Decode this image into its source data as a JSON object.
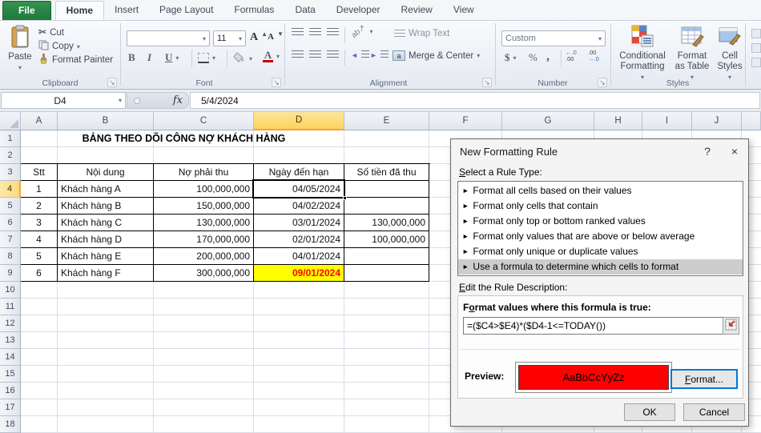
{
  "ribbon": {
    "tabs": [
      "File",
      "Home",
      "Insert",
      "Page Layout",
      "Formulas",
      "Data",
      "Developer",
      "Review",
      "View"
    ],
    "groups": {
      "clipboard": "Clipboard",
      "font": "Font",
      "alignment": "Alignment",
      "number": "Number",
      "styles": "Styles"
    },
    "clipboard": {
      "paste": "Paste",
      "cut": "Cut",
      "copy": "Copy",
      "format_painter": "Format Painter"
    },
    "font": {
      "font_name": "",
      "font_size": "11"
    },
    "alignment": {
      "wrap_text": "Wrap Text",
      "merge_center": "Merge & Center"
    },
    "number": {
      "format": "Custom",
      "dollar": "$",
      "percent": "%",
      "comma": ",",
      "inc_top": "←.0",
      "inc_bot": ".00",
      "dec_top": ".00",
      "dec_bot": "→.0"
    },
    "styles": {
      "conditional_formatting": "Conditional Formatting",
      "format_as_table": "Format as Table",
      "cell_styles": "Cell Styles"
    }
  },
  "formula_bar": {
    "name_box": "D4",
    "fx": "fx",
    "value": "5/4/2024"
  },
  "sheet": {
    "columns": [
      "A",
      "B",
      "C",
      "D",
      "E",
      "F",
      "G",
      "H",
      "I",
      "J"
    ],
    "visible_rows": 18,
    "selected": {
      "cell": "D4",
      "column": "D",
      "row": 4,
      "value": "04/05/2024"
    },
    "table": {
      "title": "BẢNG THEO DÕI CÔNG NỢ KHÁCH HÀNG",
      "headers": [
        "Stt",
        "Nội dung",
        "Nợ phải thu",
        "Ngày đến hạn",
        "Số tiền đã thu"
      ],
      "rows": [
        [
          "1",
          "Khách hàng A",
          "100,000,000",
          "04/05/2024",
          ""
        ],
        [
          "2",
          "Khách hàng B",
          "150,000,000",
          "04/02/2024",
          ""
        ],
        [
          "3",
          "Khách hàng C",
          "130,000,000",
          "03/01/2024",
          "130,000,000"
        ],
        [
          "4",
          "Khách hàng D",
          "170,000,000",
          "02/01/2024",
          "100,000,000"
        ],
        [
          "5",
          "Khách hàng E",
          "200,000,000",
          "04/01/2024",
          ""
        ],
        [
          "6",
          "Khách hàng F",
          "300,000,000",
          "09/01/2024",
          ""
        ]
      ]
    },
    "highlight": {
      "cell": "D9",
      "row": 9,
      "col_index": 3,
      "bg": "#FFFF00",
      "text_color": "#FF0000"
    }
  },
  "dialog": {
    "title": "New Formatting Rule",
    "help_glyph": "?",
    "close_glyph": "×",
    "rule_type_label": "Select a Rule Type:",
    "rule_types": [
      "Format all cells based on their values",
      "Format only cells that contain",
      "Format only top or bottom ranked values",
      "Format only values that are above or below average",
      "Format only unique or duplicate values",
      "Use a formula to determine which cells to format"
    ],
    "selected_rule_index": 5,
    "description_label": "Edit the Rule Description:",
    "formula_label": "Format values where this formula is true:",
    "formula": "=($C4>$E4)*($D4-1<=TODAY())",
    "preview_label": "Preview:",
    "preview_text": "AaBbCcYyZz",
    "preview_bg": "#FF0000",
    "format_button": "Format...",
    "ok": "OK",
    "cancel": "Cancel"
  },
  "icons": {
    "dropdown": "▾",
    "list_arrow": "►",
    "cut_glyph": "✂",
    "launcher": "↘",
    "bold": "B",
    "italic": "I",
    "underline": "U",
    "grow_font": "A",
    "shrink_font": "A",
    "font_color": "A",
    "orientation": "ab",
    "wrap_return": "↩",
    "merge_letter": "a"
  },
  "colors": {
    "file_tab": "#1E7A3C",
    "selected_header": "#FBD35E",
    "preview_red": "#FF0000",
    "highlight_yellow": "#FFFF00",
    "highlight_red": "#FF0000",
    "focus_blue": "#0078D7"
  }
}
